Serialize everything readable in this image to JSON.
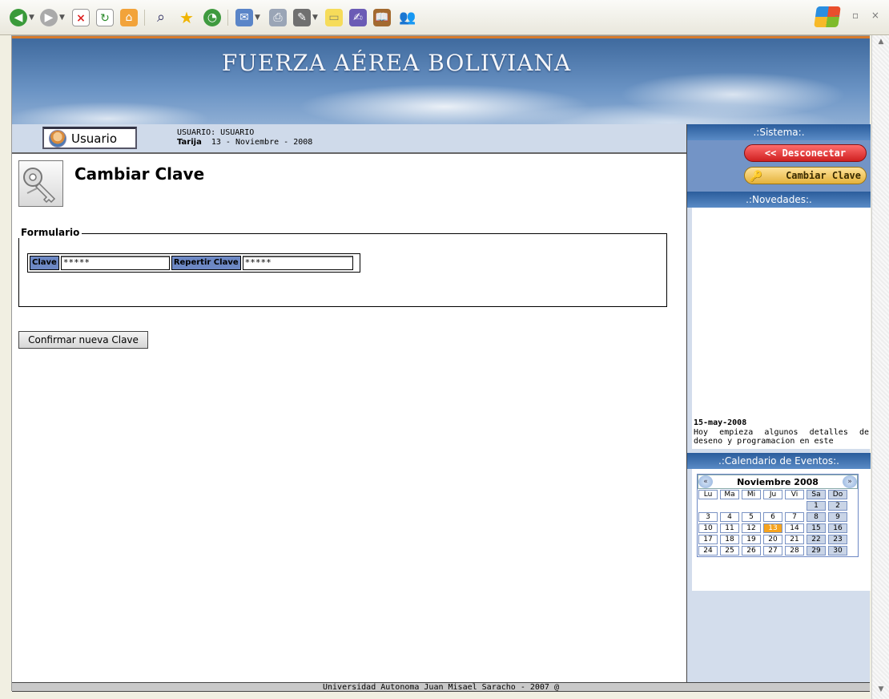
{
  "browser": {
    "toolbar_icons": [
      "back-icon",
      "forward-icon",
      "stop-icon",
      "refresh-icon",
      "home-icon",
      "search-icon",
      "favorites-icon",
      "history-icon",
      "mail-icon",
      "print-icon",
      "edit-icon",
      "notes-icon",
      "messenger-icon",
      "research-icon",
      "contacts-icon"
    ],
    "window_controls": "– ▫ ×"
  },
  "banner": {
    "title": "FUERZA AÉREA BOLIVIANA"
  },
  "userbar": {
    "button_label": "Usuario",
    "user_line": "USUARIO: USUARIO",
    "location_label": "Tarija",
    "date": "13 - Noviembre - 2008"
  },
  "main": {
    "page_title": "Cambiar Clave",
    "fieldset_legend": "Formulario",
    "fields": [
      {
        "label": "Clave",
        "value": "*****"
      },
      {
        "label": "Repertir Clave",
        "value": "*****"
      }
    ],
    "confirm_button": "Confirmar nueva Clave"
  },
  "sidebar": {
    "system_header": ".:Sistema:.",
    "disconnect_button": "<< Desconectar",
    "change_key_button": "Cambiar Clave",
    "news_header": ".:Novedades:.",
    "news_date": "15-may-2008",
    "news_text": "Hoy empieza algunos detalles de deseno y programacion en este",
    "calendar_header": ".:Calendario de Eventos:.",
    "calendar": {
      "month_label": "Noviembre 2008",
      "prev": "«",
      "next": "»",
      "days_of_week": [
        "Lu",
        "Ma",
        "Mi",
        "Ju",
        "Vi",
        "Sa",
        "Do"
      ],
      "weeks": [
        [
          "",
          "",
          "",
          "",
          "",
          "1",
          "2"
        ],
        [
          "3",
          "4",
          "5",
          "6",
          "7",
          "8",
          "9"
        ],
        [
          "10",
          "11",
          "12",
          "13",
          "14",
          "15",
          "16"
        ],
        [
          "17",
          "18",
          "19",
          "20",
          "21",
          "22",
          "23"
        ],
        [
          "24",
          "25",
          "26",
          "27",
          "28",
          "29",
          "30"
        ]
      ],
      "today": "13"
    }
  },
  "footer": {
    "text": "Universidad Autonoma Juan Misael Saracho - 2007 @"
  }
}
